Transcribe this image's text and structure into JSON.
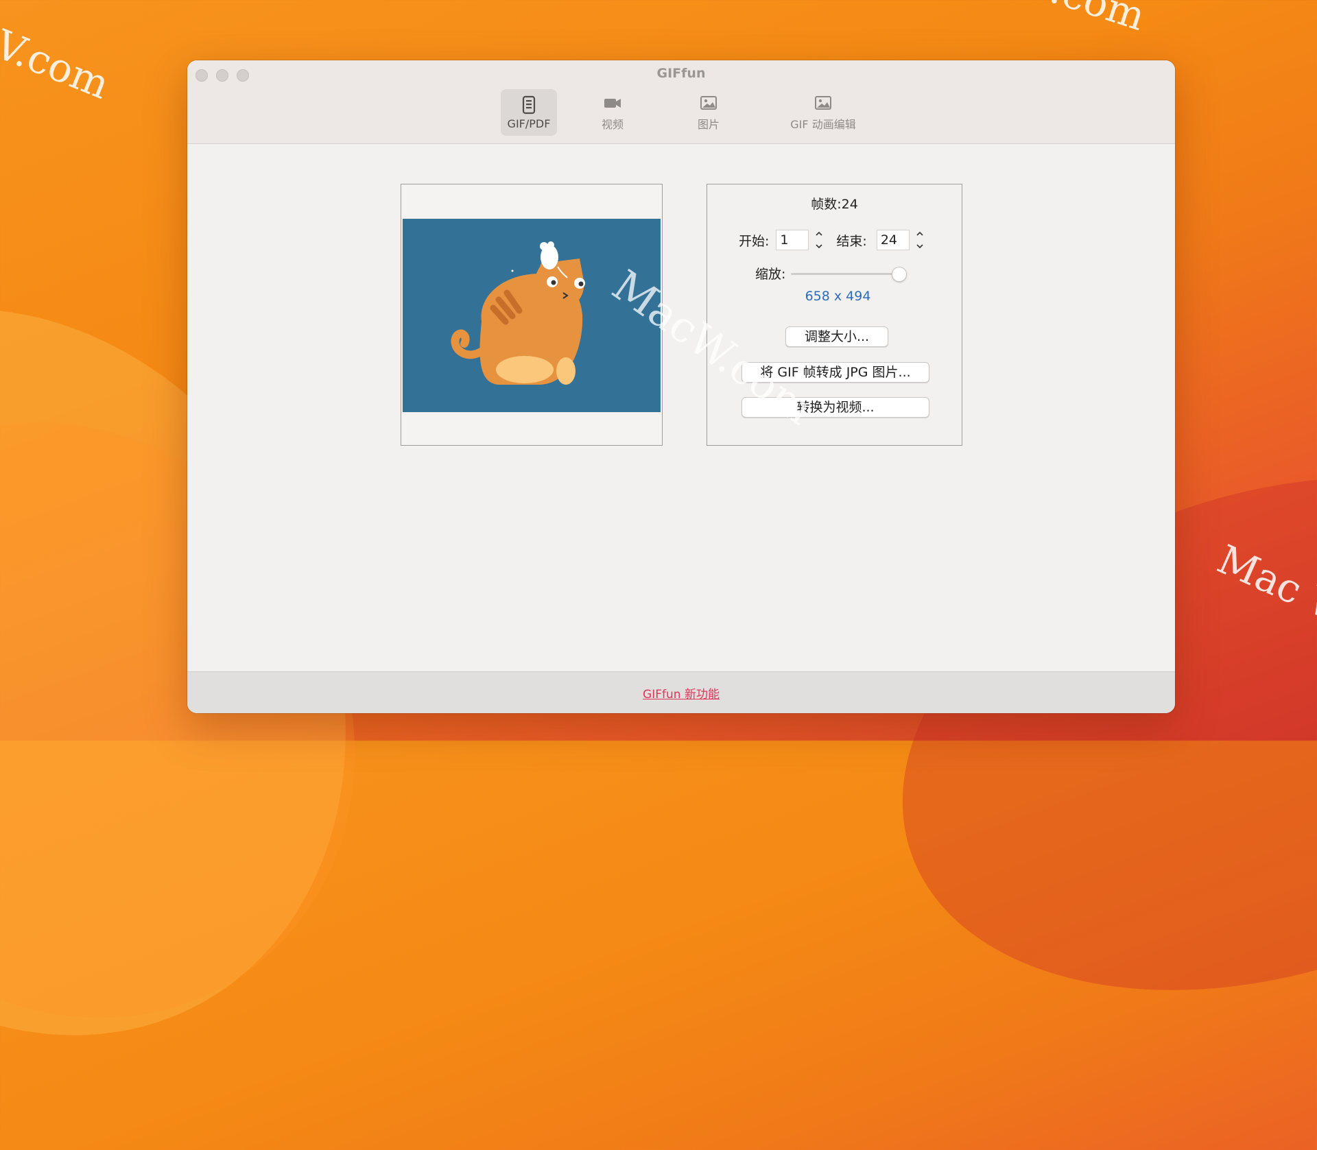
{
  "window": {
    "title": "GIFfun"
  },
  "toolbar": {
    "tabs": [
      {
        "label": "GIF/PDF",
        "icon": "document-icon",
        "active": true
      },
      {
        "label": "视频",
        "icon": "video-camera-icon",
        "active": false
      },
      {
        "label": "图片",
        "icon": "image-icon",
        "active": false
      },
      {
        "label": "GIF 动画编辑",
        "icon": "image-edit-icon",
        "active": false
      }
    ]
  },
  "settings": {
    "frames_label": "帧数:24",
    "start_label": "开始:",
    "start_value": "1",
    "end_label": "结束:",
    "end_value": "24",
    "scale_label": "缩放:",
    "scale_value": 1.0,
    "dimensions": "658 x 494",
    "resize_button": "调整大小...",
    "to_jpg_button": "将 GIF 帧转成 JPG 图片...",
    "to_video_button": "转换为视频..."
  },
  "footer": {
    "link": "GIFfun 新功能"
  },
  "watermarks": [
    "V.com",
    ".com",
    "Mac W",
    "MacW.com"
  ],
  "colors": {
    "accent_link": "#e0345a",
    "dims_text": "#2a6dc0",
    "preview_bg": "#337196",
    "cat": "#e6923f"
  }
}
